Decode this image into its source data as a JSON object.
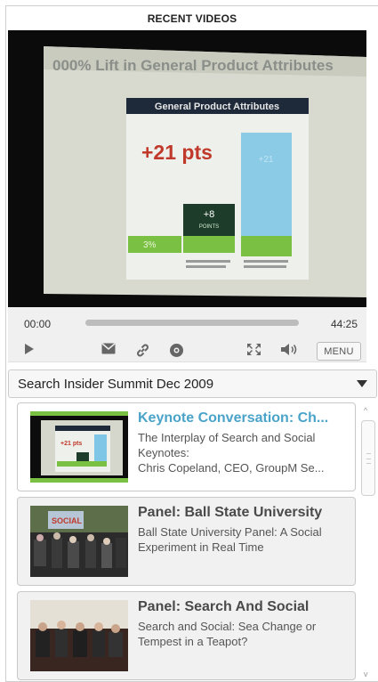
{
  "header": {
    "title": "RECENT VIDEOS"
  },
  "video": {
    "slide_heading": "General Product Attributes",
    "slide_banner": "000% Lift in General Product Attributes",
    "big_stat": "+21 pts",
    "mid_stat": "+8",
    "mid_stat_unit": "POINTS",
    "base_stat": "3%",
    "bar_right_stat": "+21"
  },
  "player": {
    "current_time": "00:00",
    "total_time": "44:25",
    "progress": 0,
    "menu_label": "MENU",
    "icons": [
      "play-icon",
      "email-icon",
      "link-icon",
      "embed-icon",
      "fullscreen-icon",
      "volume-icon"
    ]
  },
  "playlist": {
    "selected": "Search Insider Summit Dec 2009"
  },
  "videos": [
    {
      "title": "Keynote Conversation: Ch...",
      "desc": [
        "The Interplay of Search and Social",
        "Keynotes:",
        "Chris Copeland, CEO, GroupM Se..."
      ],
      "active": true
    },
    {
      "title": "Panel: Ball State University",
      "desc": [
        "Ball State University Panel: A Social",
        "Experiment in Real Time"
      ],
      "active": false
    },
    {
      "title": "Panel: Search And Social",
      "desc": [
        "Search and Social: Sea Change or",
        "Tempest in a Teapot?"
      ],
      "active": false
    }
  ],
  "colors": {
    "accent_title": "#4aa3c9",
    "slide_green": "#7ac143",
    "slide_blue": "#7fc6e6"
  }
}
